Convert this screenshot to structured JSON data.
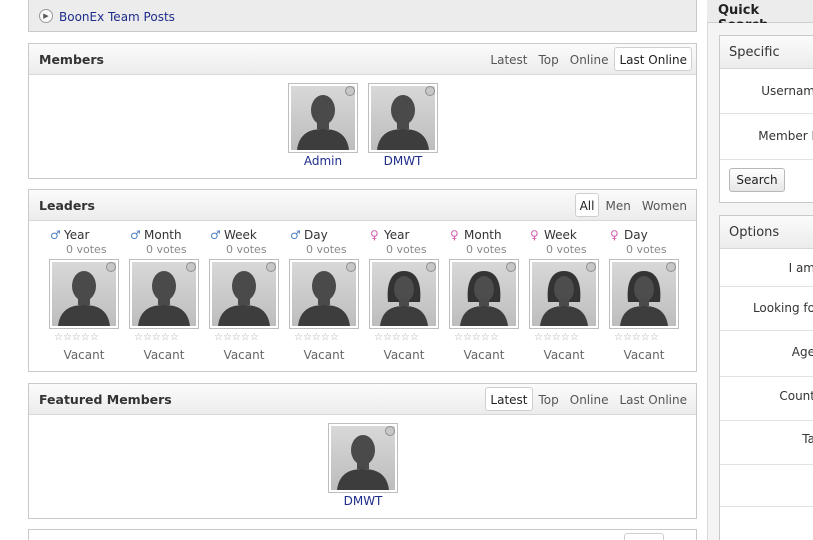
{
  "posts": {
    "link_label": "BoonEx Team Posts"
  },
  "members": {
    "title": "Members",
    "tabs": [
      "Latest",
      "Top",
      "Online",
      "Last Online"
    ],
    "active_tab": "Last Online",
    "items": [
      {
        "name": "Admin"
      },
      {
        "name": "DMWT"
      }
    ]
  },
  "leaders": {
    "title": "Leaders",
    "tabs": [
      "All",
      "Men",
      "Women"
    ],
    "active_tab": "All",
    "items": [
      {
        "period": "Year",
        "gender": "male",
        "symbol": "♂",
        "votes": "0 votes",
        "stars": "☆☆☆☆☆",
        "name": "Vacant"
      },
      {
        "period": "Month",
        "gender": "male",
        "symbol": "♂",
        "votes": "0 votes",
        "stars": "☆☆☆☆☆",
        "name": "Vacant"
      },
      {
        "period": "Week",
        "gender": "male",
        "symbol": "♂",
        "votes": "0 votes",
        "stars": "☆☆☆☆☆",
        "name": "Vacant"
      },
      {
        "period": "Day",
        "gender": "male",
        "symbol": "♂",
        "votes": "0 votes",
        "stars": "☆☆☆☆☆",
        "name": "Vacant"
      },
      {
        "period": "Year",
        "gender": "female",
        "symbol": "♀",
        "votes": "0 votes",
        "stars": "☆☆☆☆☆",
        "name": "Vacant"
      },
      {
        "period": "Month",
        "gender": "female",
        "symbol": "♀",
        "votes": "0 votes",
        "stars": "☆☆☆☆☆",
        "name": "Vacant"
      },
      {
        "period": "Week",
        "gender": "female",
        "symbol": "♀",
        "votes": "0 votes",
        "stars": "☆☆☆☆☆",
        "name": "Vacant"
      },
      {
        "period": "Day",
        "gender": "female",
        "symbol": "♀",
        "votes": "0 votes",
        "stars": "☆☆☆☆☆",
        "name": "Vacant"
      }
    ]
  },
  "featured": {
    "title": "Featured Members",
    "tabs": [
      "Latest",
      "Top",
      "Online",
      "Last Online"
    ],
    "active_tab": "Latest",
    "items": [
      {
        "name": "DMWT"
      }
    ]
  },
  "quick_search": {
    "title": "Quick Search",
    "specific": {
      "title": "Specific",
      "fields": [
        "Usernam",
        "Member I"
      ],
      "search_button": "Search"
    },
    "options": {
      "title": "Options",
      "fields": [
        "I am",
        "Looking fo",
        "Age",
        "Count",
        "Ta"
      ]
    }
  },
  "colors": {
    "link": "#1f2d8a",
    "male": "#4b7fbf",
    "female": "#d35fb0"
  },
  "icons": [
    "play-circle-icon",
    "male-icon",
    "female-icon",
    "status-dot-icon",
    "star-icon"
  ]
}
